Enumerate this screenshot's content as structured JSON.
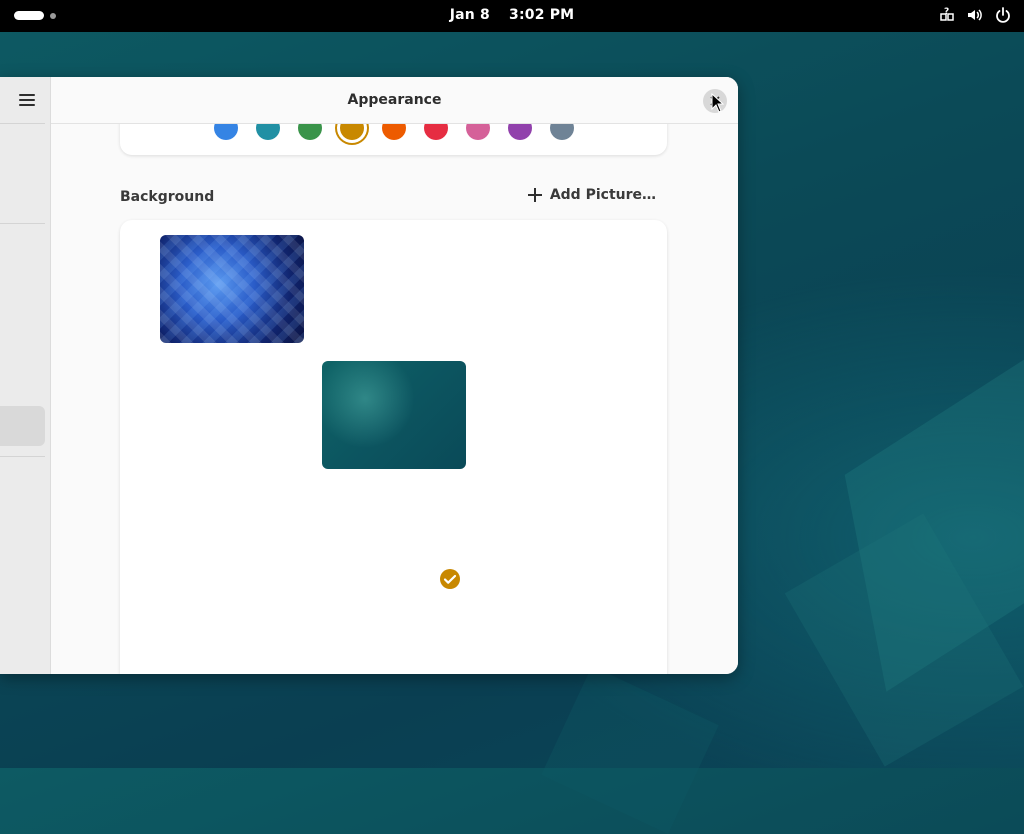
{
  "topbar": {
    "date": "Jan 8",
    "time": "3:02 PM",
    "tray_icons": [
      "accessibility-help-icon",
      "volume-icon",
      "power-icon"
    ]
  },
  "window": {
    "title": "Appearance",
    "close_icon": "close-icon",
    "sidebar_menu_icon": "hamburger-icon"
  },
  "accent_colors": [
    {
      "name": "blue",
      "hex": "#3584e4",
      "selected": false
    },
    {
      "name": "teal",
      "hex": "#2190a4",
      "selected": false
    },
    {
      "name": "green",
      "hex": "#3a944a",
      "selected": false
    },
    {
      "name": "yellow",
      "hex": "#c88800",
      "selected": true
    },
    {
      "name": "orange",
      "hex": "#ed5b00",
      "selected": false
    },
    {
      "name": "red",
      "hex": "#e62d42",
      "selected": false
    },
    {
      "name": "pink",
      "hex": "#d56199",
      "selected": false
    },
    {
      "name": "purple",
      "hex": "#9141ac",
      "selected": false
    },
    {
      "name": "slate",
      "hex": "#6f8396",
      "selected": false
    }
  ],
  "background": {
    "section_label": "Background",
    "add_picture_label": "Add Picture…",
    "wallpapers": [
      {
        "name": "blue-geometric-wallpaper",
        "selected": false
      },
      {
        "name": "teal-abstract-wallpaper",
        "selected": false
      }
    ],
    "selected_badge_icon": "checkmark-icon"
  }
}
